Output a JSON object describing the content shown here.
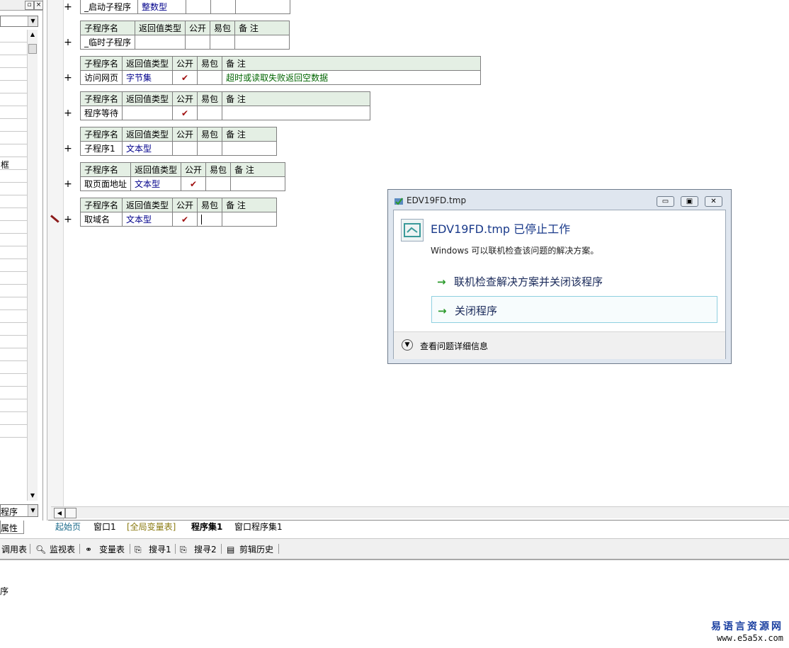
{
  "left_panel": {
    "list_row_label": "框",
    "combo_value": "程序",
    "tab_label": "属性"
  },
  "subprograms": [
    {
      "headers": [
        "子程序名",
        "返回值类型",
        "公开",
        "易包",
        "备 注"
      ],
      "name": "_启动子程序",
      "ret": "整数型",
      "public": "",
      "note": ""
    },
    {
      "headers": [
        "子程序名",
        "返回值类型",
        "公开",
        "易包",
        "备 注"
      ],
      "name": "_临时子程序",
      "ret": "",
      "public": "",
      "note": ""
    },
    {
      "headers": [
        "子程序名",
        "返回值类型",
        "公开",
        "易包",
        "备 注"
      ],
      "name": "访问网页",
      "ret": "字节集",
      "public": "✔",
      "note": "超时或读取失败返回空数据"
    },
    {
      "headers": [
        "子程序名",
        "返回值类型",
        "公开",
        "易包",
        "备 注"
      ],
      "name": "程序等待",
      "ret": "",
      "public": "✔",
      "note": ""
    },
    {
      "headers": [
        "子程序名",
        "返回值类型",
        "公开",
        "易包",
        "备 注"
      ],
      "name": "子程序1",
      "ret": "文本型",
      "public": "",
      "note": ""
    },
    {
      "headers": [
        "子程序名",
        "返回值类型",
        "公开",
        "易包",
        "备 注"
      ],
      "name": "取页面地址",
      "ret": "文本型",
      "public": "✔",
      "note": ""
    },
    {
      "headers": [
        "子程序名",
        "返回值类型",
        "公开",
        "易包",
        "备 注"
      ],
      "name": "取域名",
      "ret": "文本型",
      "public": "✔",
      "note": ""
    }
  ],
  "plus_sign": "+",
  "editor_tabs": [
    "起始页",
    "窗口1",
    "[全局变量表]",
    "程序集1",
    "窗口程序集1"
  ],
  "bottom_toolbar": [
    "调用表",
    "监视表",
    "变量表",
    "搜寻1",
    "搜寻2",
    "剪辑历史"
  ],
  "output_text": "序",
  "watermark": {
    "line1": "易语言资源网",
    "line2": "www.e5a5x.com"
  },
  "dialog": {
    "title": "EDV19FD.tmp",
    "heading": "EDV19FD.tmp 已停止工作",
    "subtext": "Windows 可以联机检查该问题的解决方案。",
    "option1": "联机检查解决方案并关闭该程序",
    "option2": "关闭程序",
    "details": "查看问题详细信息",
    "arrow_icon": "→"
  }
}
